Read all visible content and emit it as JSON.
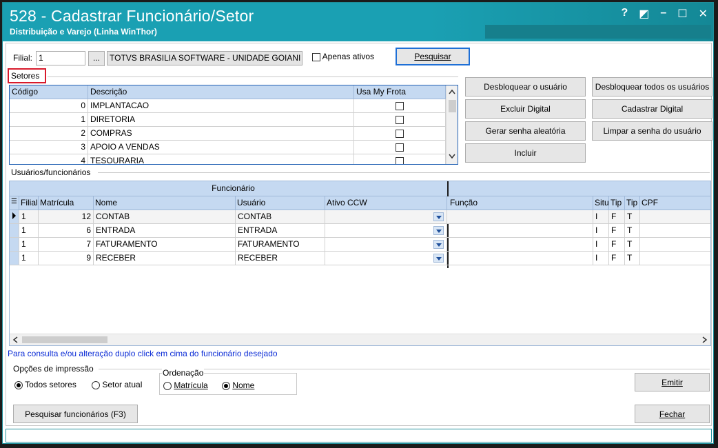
{
  "window": {
    "title": "528 - Cadastrar Funcionário/Setor",
    "subtitle": "Distribuição e Varejo (Linha WinThor)",
    "help_glyph": "?",
    "restore_glyph": "◩",
    "min_glyph": "–",
    "max_glyph": "☐",
    "close_glyph": "✕"
  },
  "filter": {
    "filial_label": "Filial:",
    "filial_value": "1",
    "lookup_label": "...",
    "company_value": "TOTVS BRASILIA SOFTWARE - UNIDADE GOIANI",
    "only_active_label": "Apenas ativos",
    "search_button": "Pesquisar"
  },
  "setores": {
    "group_label": "Setores",
    "columns": [
      "Código",
      "Descrição",
      "Usa My Frota"
    ],
    "rows": [
      {
        "codigo": "0",
        "descricao": "IMPLANTACAO"
      },
      {
        "codigo": "1",
        "descricao": "DIRETORIA"
      },
      {
        "codigo": "2",
        "descricao": "COMPRAS"
      },
      {
        "codigo": "3",
        "descricao": "APOIO A VENDAS"
      },
      {
        "codigo": "4",
        "descricao": "TESOURARIA"
      }
    ]
  },
  "actions": {
    "desbloquear": "Desbloquear o usuário",
    "desbloquear_todos": "Desbloquear todos os usuários",
    "excluir_digital": "Excluir Digital",
    "cadastrar_digital": "Cadastrar Digital",
    "gerar_senha": "Gerar senha aleatória",
    "limpar_senha": "Limpar a senha do usuário",
    "incluir": "Incluir"
  },
  "usuarios": {
    "group_label": "Usuários/funcionários",
    "band_label": "Funcionário",
    "columns": [
      "Filial",
      "Matrícula",
      "Nome",
      "Usuário",
      "Ativo CCW",
      "Função",
      "Situ",
      "Tip",
      "Tip",
      "CPF"
    ],
    "rows": [
      {
        "filial": "1",
        "matricula": "12",
        "nome": "CONTAB",
        "usuario": "CONTAB",
        "situ": "I",
        "tip1": "F",
        "tip2": "T"
      },
      {
        "filial": "1",
        "matricula": "6",
        "nome": "ENTRADA",
        "usuario": "ENTRADA",
        "situ": "I",
        "tip1": "F",
        "tip2": "T"
      },
      {
        "filial": "1",
        "matricula": "7",
        "nome": "FATURAMENTO",
        "usuario": "FATURAMENTO",
        "situ": "I",
        "tip1": "F",
        "tip2": "T"
      },
      {
        "filial": "1",
        "matricula": "9",
        "nome": "RECEBER",
        "usuario": "RECEBER",
        "situ": "I",
        "tip1": "F",
        "tip2": "T"
      }
    ]
  },
  "hint": "Para consulta e/ou alteração duplo click em cima do funcionário desejado",
  "print": {
    "group_label": "Opções de impressão",
    "todos_setores": "Todos setores",
    "setor_atual": "Setor atual",
    "ordenacao_label": "Ordenação",
    "matricula": "Matrícula",
    "nome": "Nome",
    "emitir": "Emitir"
  },
  "footer": {
    "pesquisar_funcionarios": "Pesquisar funcionários (F3)",
    "fechar": "Fechar"
  },
  "colors": {
    "titlebar": "#1aa0b3",
    "grid_header": "#c5d9f1",
    "highlight_red": "#d8192b",
    "link_blue": "#0a2bd6"
  }
}
